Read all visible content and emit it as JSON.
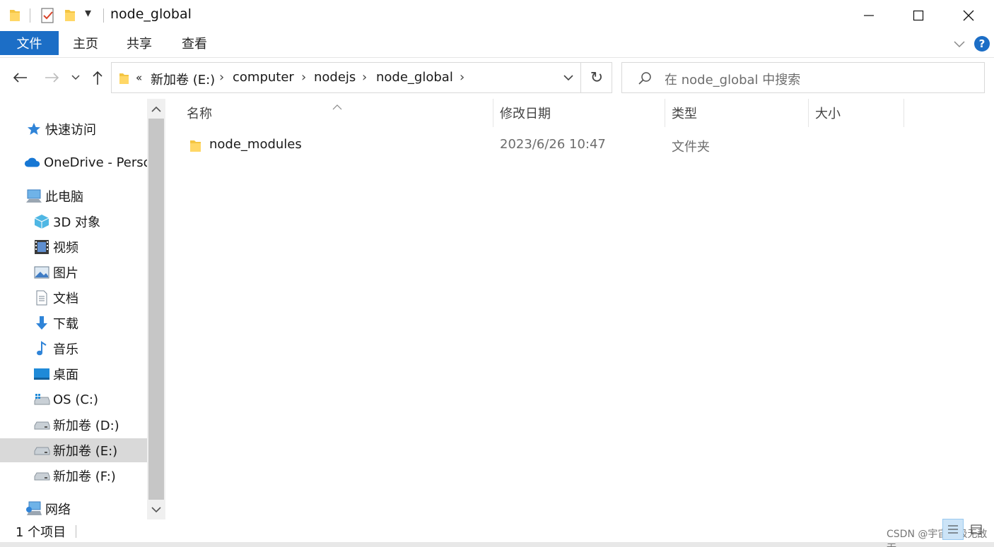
{
  "window": {
    "title": "node_global",
    "quick_access_dropdown": "▾",
    "minimize_glyph": "─",
    "maximize_glyph": "☐",
    "close_glyph": "✕"
  },
  "ribbon": {
    "tabs": [
      {
        "label": "文件",
        "active": true
      },
      {
        "label": "主页"
      },
      {
        "label": "共享"
      },
      {
        "label": "查看"
      }
    ],
    "expand_glyph": "∨",
    "help_glyph": "?"
  },
  "navigation": {
    "back_glyph": "←",
    "forward_glyph": "→",
    "recent_glyph": "⌄",
    "up_glyph": "↑"
  },
  "address": {
    "overflow": "«",
    "breadcrumbs": [
      "新加卷 (E:)",
      "computer",
      "nodejs",
      "node_global"
    ],
    "separator": "›",
    "dropdown_glyph": "∨",
    "refresh_glyph": "↻"
  },
  "search": {
    "placeholder": "在 node_global 中搜索"
  },
  "tree": {
    "items": [
      {
        "label": "快速访问",
        "icon": "star-icon"
      },
      {
        "label": "OneDrive - Perso",
        "icon": "cloud-icon"
      },
      {
        "label": "此电脑",
        "icon": "computer-icon"
      },
      {
        "label": "3D 对象",
        "icon": "cube-3d-icon"
      },
      {
        "label": "视频",
        "icon": "video-icon"
      },
      {
        "label": "图片",
        "icon": "picture-icon"
      },
      {
        "label": "文档",
        "icon": "document-icon"
      },
      {
        "label": "下载",
        "icon": "download-icon"
      },
      {
        "label": "音乐",
        "icon": "music-icon"
      },
      {
        "label": "桌面",
        "icon": "desktop-icon"
      },
      {
        "label": "OS (C:)",
        "icon": "os-drive-icon"
      },
      {
        "label": "新加卷 (D:)",
        "icon": "drive-icon"
      },
      {
        "label": "新加卷 (E:)",
        "icon": "drive-icon",
        "selected": true
      },
      {
        "label": "新加卷 (F:)",
        "icon": "drive-icon"
      },
      {
        "label": "网络",
        "icon": "network-icon"
      }
    ]
  },
  "file_list": {
    "columns": [
      "名称",
      "修改日期",
      "类型",
      "大小"
    ],
    "sort_glyph": "^",
    "rows": [
      {
        "name": "node_modules",
        "modified": "2023/6/26 10:47",
        "type": "文件夹",
        "size": ""
      }
    ]
  },
  "status": {
    "item_count": "1 个项目"
  },
  "watermark": "CSDN @宇宙超级无敌无"
}
